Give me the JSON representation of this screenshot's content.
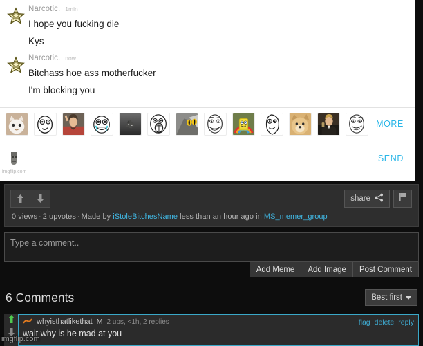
{
  "chat": {
    "groups": [
      {
        "name": "Narcotic.",
        "time": "1min",
        "avatar_icon": "star-avatar-icon",
        "lines": [
          "I hope you fucking die",
          "Kys"
        ]
      },
      {
        "name": "Narcotic.",
        "time": "now",
        "avatar_icon": "star-avatar-icon",
        "lines": [
          "Bitchass hoe ass motherfucker",
          "I'm blocking you"
        ]
      }
    ],
    "meme_strip": {
      "more_label": "MORE",
      "thumbnails": [
        "cat-meme-thumb",
        "rage-derp-thumb",
        "jesus-thumb",
        "happy-troll-thumb",
        "dark-cat-thumb",
        "lol-guy-thumb",
        "yellow-eyes-cat-thumb",
        "me-gusta-thumb",
        "spongebob-rainbow-thumb",
        "derp-face-thumb",
        "doge-thumb",
        "leonardo-cheers-thumb",
        "challenge-accepted-thumb"
      ]
    },
    "send_row": {
      "attachment_icon": "moai-statue-thumb",
      "send_label": "SEND"
    },
    "watermark": "imgflip.com"
  },
  "post": {
    "upvote_icon": "arrow-up-icon",
    "downvote_icon": "arrow-down-icon",
    "share_label": "share",
    "share_icon": "share-nodes-icon",
    "flag_icon": "flag-icon",
    "stats": {
      "views": "0 views",
      "upvotes": "2 upvotes",
      "made_by_prefix": "Made by",
      "author": "iStoleBitchesName",
      "time": "less than an hour ago in",
      "stream": "MS_memer_group",
      "separator": "·"
    }
  },
  "compose": {
    "placeholder": "Type a comment..",
    "value": "",
    "add_meme_label": "Add Meme",
    "add_image_label": "Add Image",
    "post_comment_label": "Post Comment"
  },
  "comments_section": {
    "title": "6 Comments",
    "sort_label": "Best first",
    "sort_caret_icon": "caret-down-icon",
    "comments": [
      {
        "avatar_icon": "orange-scribble-avatar-icon",
        "username": "whyisthatlikethat",
        "badge": "M",
        "info": "2 ups, <1h, 2 replies",
        "text": "wait why is he mad at you",
        "upvote_icon": "green-arrow-up-icon",
        "downvote_icon": "gray-arrow-down-icon",
        "actions": [
          "flag",
          "delete",
          "reply"
        ]
      }
    ]
  },
  "watermark_bottom": "imgflip.com",
  "colors": {
    "link_blue": "#40b5e0",
    "chat_link": "#29b6e8",
    "panel_dark": "#2e2e2e",
    "page_bg": "#0d0d0d",
    "highlight_border": "#3aa8c8",
    "upvote_green": "#4fc94f"
  }
}
